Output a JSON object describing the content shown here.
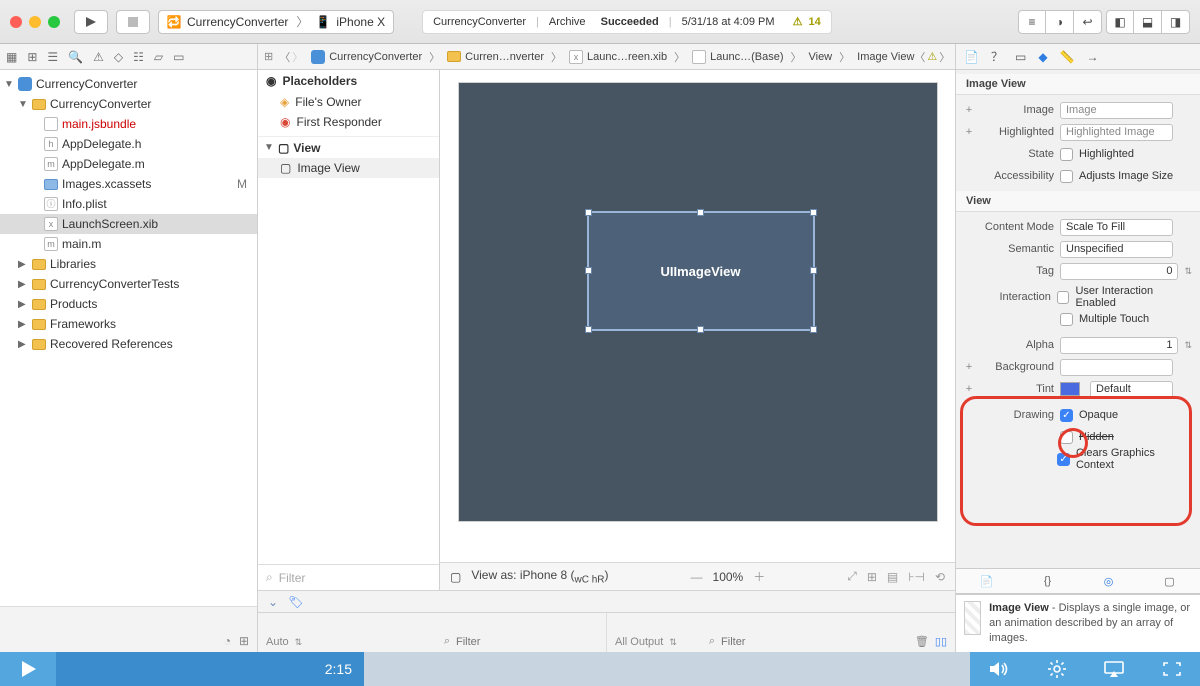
{
  "toolbar": {
    "scheme_project": "CurrencyConverter",
    "scheme_device": "iPhone X",
    "status_project": "CurrencyConverter",
    "status_action": "Archive",
    "status_result": "Succeeded",
    "status_time": "5/31/18 at 4:09 PM",
    "status_warn_count": "14"
  },
  "breadcrumb": [
    "CurrencyConverter",
    "Curren…nverter",
    "Launc…reen.xib",
    "Launc…(Base)",
    "View",
    "Image View"
  ],
  "navigator": {
    "root": "CurrencyConverter",
    "items": [
      {
        "name": "CurrencyConverter",
        "type": "folder",
        "depth": 1,
        "open": true
      },
      {
        "name": "main.jsbundle",
        "type": "file",
        "depth": 2,
        "red": true
      },
      {
        "name": "AppDelegate.h",
        "type": "h",
        "depth": 2
      },
      {
        "name": "AppDelegate.m",
        "type": "m",
        "depth": 2
      },
      {
        "name": "Images.xcassets",
        "type": "bluefolder",
        "depth": 2,
        "mod": "M"
      },
      {
        "name": "Info.plist",
        "type": "plist",
        "depth": 2
      },
      {
        "name": "LaunchScreen.xib",
        "type": "xib",
        "depth": 2,
        "sel": true
      },
      {
        "name": "main.m",
        "type": "m",
        "depth": 2
      },
      {
        "name": "Libraries",
        "type": "folder",
        "depth": 1
      },
      {
        "name": "CurrencyConverterTests",
        "type": "folder",
        "depth": 1
      },
      {
        "name": "Products",
        "type": "folder",
        "depth": 1
      },
      {
        "name": "Frameworks",
        "type": "folder",
        "depth": 1
      },
      {
        "name": "Recovered References",
        "type": "folder",
        "depth": 1
      }
    ]
  },
  "outline": {
    "placeholders_label": "Placeholders",
    "placeholders": [
      "File's Owner",
      "First Responder"
    ],
    "view_label": "View",
    "view_items": [
      "Image View"
    ],
    "filter_placeholder": "Filter"
  },
  "canvas": {
    "selection_label": "UIImageView",
    "viewas_label": "View as: iPhone 8 (",
    "viewas_wc": "wC ",
    "viewas_hr": "hR",
    "viewas_close": ")",
    "zoom": "100%"
  },
  "inspector": {
    "section_imageview": "Image View",
    "image_label": "Image",
    "image_placeholder": "Image",
    "highlighted_label": "Highlighted",
    "highlighted_placeholder": "Highlighted Image",
    "state_label": "State",
    "state_option": "Highlighted",
    "accessibility_label": "Accessibility",
    "accessibility_option": "Adjusts Image Size",
    "section_view": "View",
    "contentmode_label": "Content Mode",
    "contentmode_value": "Scale To Fill",
    "semantic_label": "Semantic",
    "semantic_value": "Unspecified",
    "tag_label": "Tag",
    "tag_value": "0",
    "interaction_label": "Interaction",
    "interaction_option1": "User Interaction Enabled",
    "interaction_option2": "Multiple Touch",
    "alpha_label": "Alpha",
    "alpha_value": "1",
    "background_label": "Background",
    "tint_label": "Tint",
    "tint_value": "Default",
    "drawing_label": "Drawing",
    "drawing_opaque": "Opaque",
    "drawing_hidden": "Hidden",
    "drawing_clears": "Clears Graphics Context",
    "objlib_title": "Image View",
    "objlib_desc": " - Displays a single image, or an animation described by an array of images."
  },
  "debug": {
    "auto_label": "Auto",
    "filter_placeholder": "Filter",
    "alloutput_label": "All Output"
  },
  "video": {
    "time": "2:15"
  }
}
